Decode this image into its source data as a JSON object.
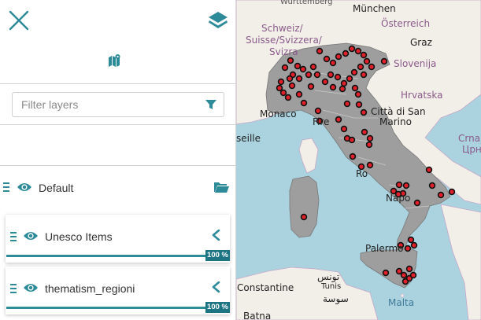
{
  "map": {
    "labels": {
      "wurttemberg": "Württemberg",
      "munchen": "München",
      "osterreich": "Österreich",
      "schweiz": "Schweiz/",
      "suisse": "Suisse/Svizzera/",
      "svizra": "Svizra",
      "graz": "Graz",
      "slovenija": "Slovenija",
      "hrvatska": "Hrvatska",
      "monaco": "Monaco",
      "citta_san_marino": "Città di San",
      "marino": "Marino",
      "firenze": "Fire",
      "marseille": "seille",
      "roma": "Ro",
      "napoli": "Napo",
      "palermo": "Palermo",
      "tunis": "تونس",
      "tunis_latin": "Tunis",
      "sousse": "سوسة",
      "constantine": "Constantine",
      "batna": "Batna",
      "malta": "Malta",
      "crna": "Crna",
      "crna_cyr": "Црн"
    }
  },
  "panel": {
    "filter": {
      "placeholder": "Filter layers"
    },
    "group": {
      "label": "Default"
    },
    "layers": [
      {
        "name": "Unesco Items",
        "opacity": "100 %",
        "opacity_value": 100
      },
      {
        "name": "thematism_regioni",
        "opacity": "100 %",
        "opacity_value": 100
      }
    ]
  },
  "colors": {
    "accent": "#2d8a99",
    "badge": "#1d7483",
    "sea": "#aad3df",
    "land": "#f2efe9",
    "italy_fill": "#9e9e9e",
    "marker_fill": "#e0202a"
  }
}
